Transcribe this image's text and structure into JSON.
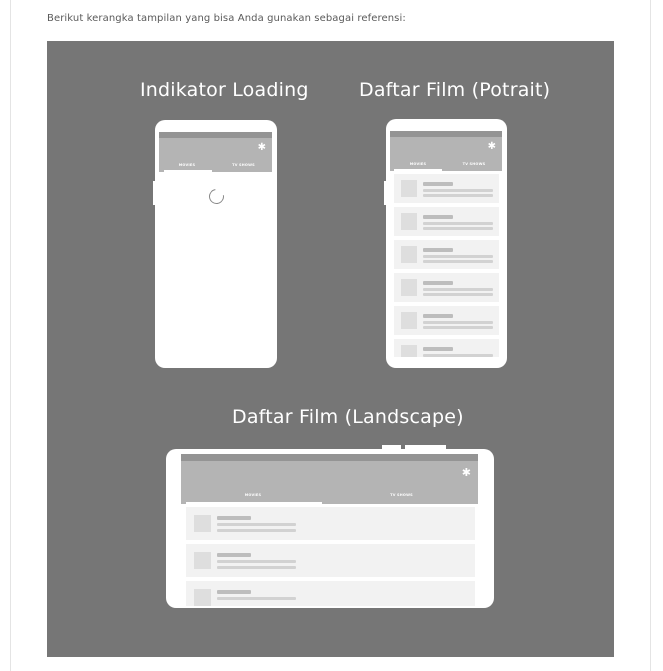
{
  "intro_text": "Berikut kerangka tampilan yang bisa Anda gunakan sebagai referensi:",
  "titles": {
    "loading": "Indikator Loading",
    "portrait": "Daftar Film (Potrait)",
    "landscape": "Daftar Film (Landscape)"
  },
  "tabs": {
    "movies": "MOVIES",
    "tv_shows": "TV SHOWS"
  },
  "icons": {
    "settings": "gear-icon",
    "loading": "spinner-icon"
  },
  "colors": {
    "panel_background": "#767676",
    "phone_body": "#ffffff",
    "status_bar": "#949494",
    "toolbar": "#b4b4b4",
    "list_card": "#f2f2f2"
  }
}
